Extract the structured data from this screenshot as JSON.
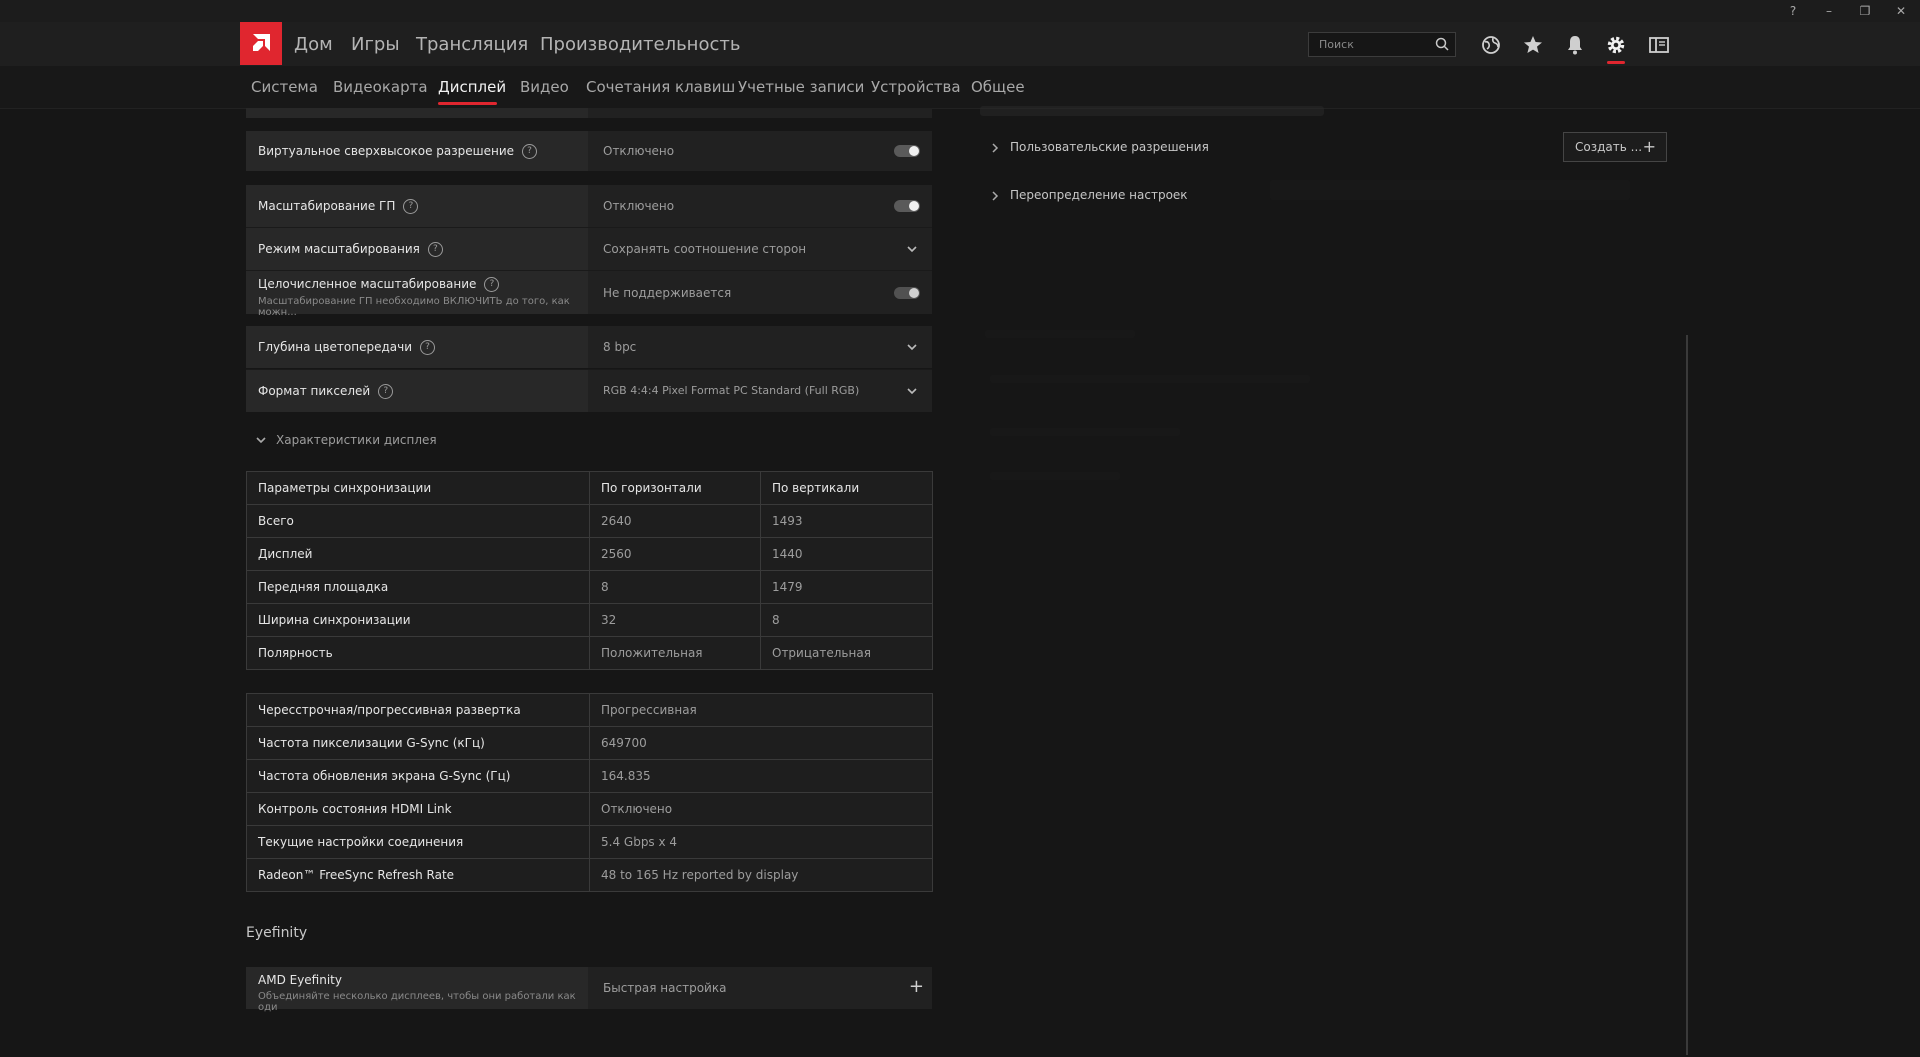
{
  "window": {
    "help": "?",
    "minimize": "–",
    "restore": "❐",
    "close": "✕"
  },
  "nav": {
    "items": [
      "Дом",
      "Игры",
      "Трансляция",
      "Производительность"
    ]
  },
  "search": {
    "placeholder": "Поиск"
  },
  "subnav": {
    "items": [
      "Система",
      "Видеокарта",
      "Дисплей",
      "Видео",
      "Сочетания клавиш",
      "Учетные записи",
      "Устройства",
      "Общее"
    ],
    "active": "Дисплей"
  },
  "settings": {
    "virtual_sr": {
      "label": "Виртуальное сверхвысокое разрешение",
      "value": "Отключено"
    },
    "gpu_scaling": {
      "label": "Масштабирование ГП",
      "value": "Отключено"
    },
    "scaling_mode": {
      "label": "Режим масштабирования",
      "value": "Сохранять соотношение сторон"
    },
    "integer_scaling": {
      "label": "Целочисленное масштабирование",
      "sub": "Масштабирование ГП необходимо ВКЛЮЧИТЬ до того, как можн...",
      "value": "Не поддерживается"
    },
    "color_depth": {
      "label": "Глубина цветопередачи",
      "value": "8 bpc"
    },
    "pixel_format": {
      "label": "Формат пикселей",
      "value": "RGB 4:4:4 Pixel Format PC Standard (Full RGB)"
    }
  },
  "display_specs": {
    "title": "Характеристики дисплея"
  },
  "timing": {
    "headers": [
      "Параметры синхронизации",
      "По горизонтали",
      "По вертикали"
    ],
    "rows": [
      [
        "Всего",
        "2640",
        "1493"
      ],
      [
        "Дисплей",
        "2560",
        "1440"
      ],
      [
        "Передняя площадка",
        "8",
        "1479"
      ],
      [
        "Ширина синхронизации",
        "32",
        "8"
      ],
      [
        "Полярность",
        "Положительная",
        "Отрицательная"
      ]
    ]
  },
  "info": {
    "rows": [
      [
        "Чересстрочная/прогрессивная развертка",
        "Прогрессивная"
      ],
      [
        "Частота пикселизации G-Sync (кГц)",
        "649700"
      ],
      [
        "Частота обновления экрана G-Sync (Гц)",
        "164.835"
      ],
      [
        "Контроль состояния HDMI Link",
        "Отключено"
      ],
      [
        "Текущие настройки соединения",
        "5.4 Gbps x 4"
      ],
      [
        "Radeon™ FreeSync Refresh Rate",
        "48 to 165 Hz reported by display"
      ]
    ]
  },
  "eyefinity": {
    "title": "Eyefinity",
    "label": "AMD Eyefinity",
    "sub": "Объединяйте несколько дисплеев, чтобы они работали как оди",
    "value": "Быстрая настройка"
  },
  "right_panel": {
    "custom_res": "Пользовательские разрешения",
    "create_label": "Создать ...",
    "override": "Переопределение настроек"
  }
}
